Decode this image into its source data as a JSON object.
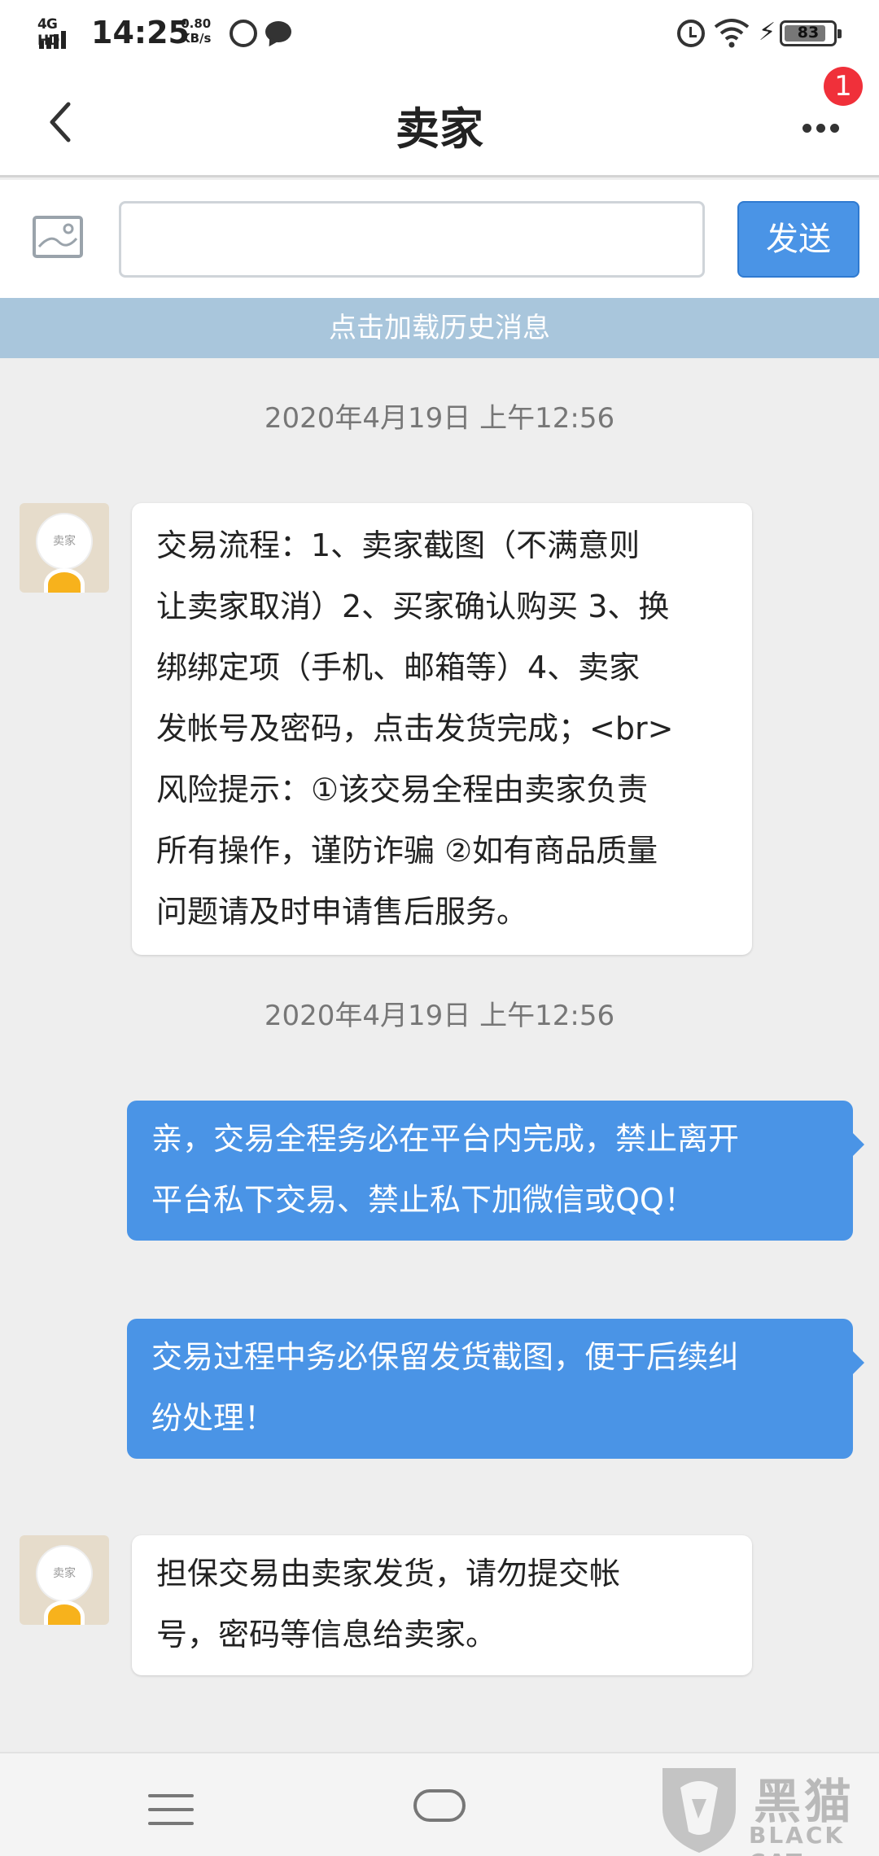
{
  "status_bar": {
    "network": "4G HD",
    "time": "14:25",
    "speed_value": "0.80",
    "speed_unit": "KB/s",
    "battery": "83"
  },
  "header": {
    "title": "卖家",
    "badge_count": "1"
  },
  "composer": {
    "input_value": "",
    "send_label": "发送"
  },
  "history_label": "点击加载历史消息",
  "messages": [
    {
      "type": "timestamp",
      "text": "2020年4月19日 上午12:56"
    },
    {
      "type": "incoming",
      "avatar_label": "卖家",
      "lines": [
        "交易流程：1、卖家截图（不满意则",
        "让卖家取消）2、买家确认购买 3、换",
        "绑绑定项（手机、邮箱等）4、卖家",
        "发帐号及密码，点击发货完成；<br>",
        "风险提示：①该交易全程由卖家负责",
        "所有操作，谨防诈骗 ②如有商品质量",
        "问题请及时申请售后服务。"
      ]
    },
    {
      "type": "timestamp",
      "text": "2020年4月19日 上午12:56"
    },
    {
      "type": "outgoing",
      "lines": [
        "亲，交易全程务必在平台内完成，禁止离开",
        "平台私下交易、禁止私下加微信或QQ！"
      ]
    },
    {
      "type": "outgoing",
      "lines": [
        "交易过程中务必保留发货截图，便于后续纠",
        "纷处理！"
      ]
    },
    {
      "type": "incoming",
      "avatar_label": "卖家",
      "lines": [
        "担保交易由卖家发货，请勿提交帐",
        "号，密码等信息给卖家。"
      ]
    }
  ],
  "watermark": {
    "cn": "黑猫",
    "en": "BLACK CAT"
  },
  "colors": {
    "accent": "#4a94e6",
    "history_bar": "#a9c6dc",
    "badge": "#f0303a",
    "background": "#eeeeee"
  }
}
